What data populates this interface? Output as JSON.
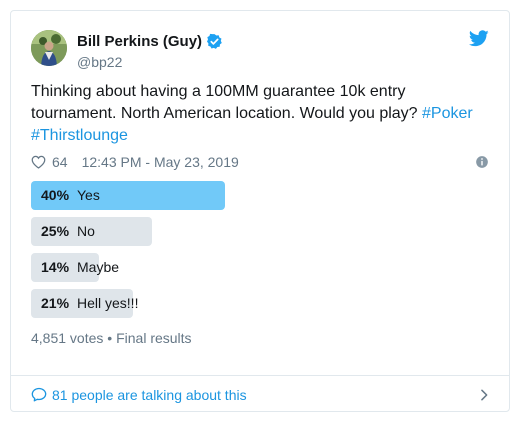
{
  "tweet": {
    "display_name": "Bill Perkins (Guy)",
    "handle": "@bp22",
    "text_prefix": "Thinking about having a 100MM guarantee 10k entry tournament. North American location. Would you play?",
    "hashtags": [
      "#Poker",
      "#Thirstlounge"
    ],
    "likes": "64",
    "timestamp": "12:43 PM - May 23, 2019",
    "icons": {
      "verified": "verified-badge-icon",
      "brand": "twitter-bird-icon",
      "like": "heart-icon",
      "info": "info-icon",
      "reply": "speech-bubble-icon",
      "more": "chevron-right-icon"
    }
  },
  "poll": {
    "choices": [
      {
        "percent": "40%",
        "label": "Yes",
        "fraction": 0.4,
        "winner": true
      },
      {
        "percent": "25%",
        "label": "No",
        "fraction": 0.25,
        "winner": false
      },
      {
        "percent": "14%",
        "label": "Maybe",
        "fraction": 0.14,
        "winner": false
      },
      {
        "percent": "21%",
        "label": "Hell yes!!!",
        "fraction": 0.21,
        "winner": false
      }
    ],
    "votes": "4,851 votes",
    "separator": "•",
    "status": "Final results"
  },
  "footer": {
    "talking": "81 people are talking about this"
  },
  "colors": {
    "accent": "#1da1f2",
    "link": "#1b95e0",
    "winner_bar": "#71c9f8",
    "bar": "#dfe5ea",
    "muted": "#657786"
  }
}
